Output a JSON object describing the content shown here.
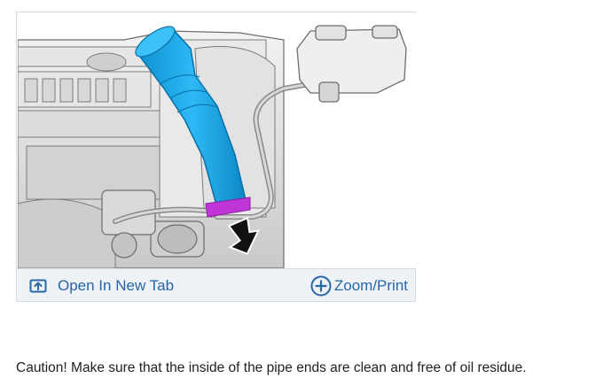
{
  "figure": {
    "open_tab_label": "Open In New Tab",
    "zoom_print_label": "Zoom/Print",
    "icons": {
      "open_tab": "open-in-new-tab-icon",
      "zoom": "plus-circle-icon"
    },
    "colors": {
      "link": "#2767a8",
      "pipe": "#1aa9ea",
      "seal": "#c035d8",
      "bar": "#eef1f5"
    }
  },
  "caution": {
    "text": "Caution! Make sure that the inside of the pipe ends are clean and free of oil residue."
  }
}
